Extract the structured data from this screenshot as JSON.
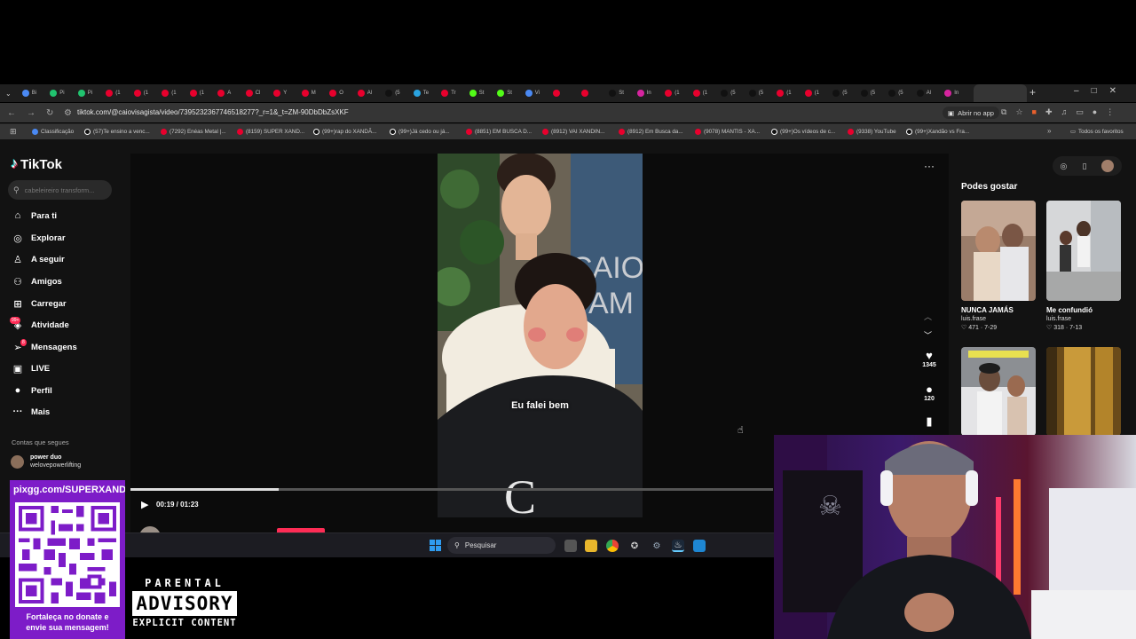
{
  "browser": {
    "tab_count": 36,
    "tabs": [
      {
        "label": "Bi",
        "color": "#4a89f3"
      },
      {
        "label": "Pi",
        "color": "#21c36f"
      },
      {
        "label": "Pi",
        "color": "#21c36f"
      },
      {
        "label": "(1",
        "color": "#e8002d"
      },
      {
        "label": "(1",
        "color": "#e8002d"
      },
      {
        "label": "(1",
        "color": "#e8002d"
      },
      {
        "label": "(1",
        "color": "#e8002d"
      },
      {
        "label": "A",
        "color": "#e8002d"
      },
      {
        "label": "Cl",
        "color": "#e8002d"
      },
      {
        "label": "Y",
        "color": "#e8002d"
      },
      {
        "label": "M",
        "color": "#e8002d"
      },
      {
        "label": "O",
        "color": "#e8002d"
      },
      {
        "label": "Al",
        "color": "#e8002d"
      },
      {
        "label": "(5",
        "color": "#111111"
      },
      {
        "label": "Te",
        "color": "#2aa3e0"
      },
      {
        "label": "Tr",
        "color": "#e8002d"
      },
      {
        "label": "St",
        "color": "#53fc18"
      },
      {
        "label": "St",
        "color": "#53fc18"
      },
      {
        "label": "Vi",
        "color": "#4a89f3"
      },
      {
        "label": "",
        "color": "#e8002d"
      },
      {
        "label": "",
        "color": "#e8002d"
      },
      {
        "label": "St",
        "color": "#111111"
      },
      {
        "label": "In",
        "color": "#d6249f"
      },
      {
        "label": "(1",
        "color": "#e8002d"
      },
      {
        "label": "(1",
        "color": "#e8002d"
      },
      {
        "label": "(5",
        "color": "#111111"
      },
      {
        "label": "(5",
        "color": "#111111"
      },
      {
        "label": "(1",
        "color": "#e8002d"
      },
      {
        "label": "(1",
        "color": "#e8002d"
      },
      {
        "label": "(5",
        "color": "#111111"
      },
      {
        "label": "(5",
        "color": "#111111"
      },
      {
        "label": "(5",
        "color": "#111111"
      },
      {
        "label": "Al",
        "color": "#111111"
      },
      {
        "label": "In",
        "color": "#d6249f"
      }
    ],
    "active_tab_label": "In",
    "url": "tiktok.com/@caiovisagista/video/7395232367746518277?_r=1&_t=ZM-90DbDbZsXKF",
    "open_app_label": "Abrir no app",
    "bookmarks": [
      {
        "label": "Classificação",
        "kind": "bl"
      },
      {
        "label": "(57)Te ensino a venc...",
        "kind": "tt"
      },
      {
        "label": "(7292) Enéas Metal |...",
        "kind": "yt"
      },
      {
        "label": "(8159) SUPER XAND...",
        "kind": "yt"
      },
      {
        "label": "(99+)rap do XANDÃ...",
        "kind": "tt"
      },
      {
        "label": "(99+)Já cedo ou já...",
        "kind": "tt"
      },
      {
        "label": "(8851) EM BUSCA D...",
        "kind": "yt"
      },
      {
        "label": "(8912) VAI XANDIN...",
        "kind": "yt"
      },
      {
        "label": "(8912) Em Busca da...",
        "kind": "yt"
      },
      {
        "label": "(9078) MANTIS - XA...",
        "kind": "yt"
      },
      {
        "label": "(99+)Os vídeos de c...",
        "kind": "tt"
      },
      {
        "label": "(9338) YouTube",
        "kind": "yt"
      },
      {
        "label": "(99+)Xandão vs Fra...",
        "kind": "tt"
      }
    ],
    "all_bookmarks_label": "Todos os favoritos"
  },
  "tiktok": {
    "logo": "TikTok",
    "search_placeholder": "cabeleireiro transform...",
    "nav": [
      {
        "label": "Para ti",
        "icon": "home-icon",
        "glyph": "⌂"
      },
      {
        "label": "Explorar",
        "icon": "compass-icon",
        "glyph": "◎"
      },
      {
        "label": "A seguir",
        "icon": "following-icon",
        "glyph": "♙"
      },
      {
        "label": "Amigos",
        "icon": "friends-icon",
        "glyph": "⚇"
      },
      {
        "label": "Carregar",
        "icon": "upload-icon",
        "glyph": "⊞"
      },
      {
        "label": "Atividade",
        "icon": "activity-icon",
        "glyph": "◈"
      },
      {
        "label": "Mensagens",
        "icon": "messages-icon",
        "glyph": "➢"
      },
      {
        "label": "LIVE",
        "icon": "live-icon",
        "glyph": "▣"
      },
      {
        "label": "Perfil",
        "icon": "profile-icon",
        "glyph": "●"
      },
      {
        "label": "Mais",
        "icon": "more-icon",
        "glyph": "···"
      }
    ],
    "activity_badge": "99+",
    "messages_badge": "8",
    "following_section_label": "Contas que segues",
    "following": [
      {
        "name": "power duo",
        "handle": "welovepowerlifting"
      }
    ],
    "video": {
      "caption": "Eu falei bem",
      "likes": "1345",
      "comments": "120",
      "time": "00:19 / 01:23",
      "progress": 0.23,
      "author": "caiovisagista"
    },
    "recommended_title": "Podes gostar",
    "recommended": [
      {
        "title": "NUNCA JAMÁS",
        "user": "luis.frase",
        "stats": "471 · 7-29"
      },
      {
        "title": "Me confundió",
        "user": "luis.frase",
        "stats": "318 · 7-13"
      },
      {
        "title": "",
        "user": "",
        "stats": ""
      },
      {
        "title": "",
        "user": "",
        "stats": ""
      }
    ]
  },
  "taskbar": {
    "search_placeholder": "Pesquisar"
  },
  "overlay": {
    "donate_url": "pixgg.com/SUPERXANDÃO",
    "donate_text_1": "Fortaleça no donate e",
    "donate_text_2": "envie sua mensagem!",
    "advisory_line1": "PARENTAL",
    "advisory_line2": "ADVISORY",
    "advisory_line3": "EXPLICIT CONTENT"
  }
}
